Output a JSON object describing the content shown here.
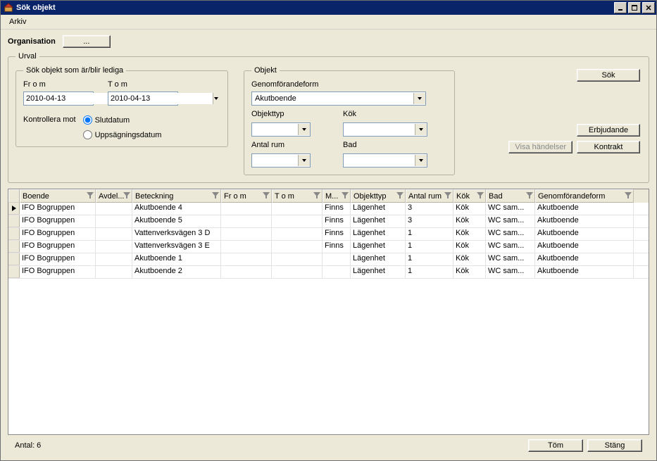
{
  "window": {
    "title": "Sök objekt"
  },
  "menu": {
    "arkiv": "Arkiv"
  },
  "top": {
    "organisation_label": "Organisation",
    "org_button": "..."
  },
  "urval": {
    "legend": "Urval",
    "dates_legend": "Sök objekt som är/blir lediga",
    "from_label": "Fr o m",
    "tom_label": "T o m",
    "from_value": "2010-04-13",
    "tom_value": "2010-04-13",
    "kontrollera_label": "Kontrollera mot",
    "radio_slut": "Slutdatum",
    "radio_upps": "Uppsägningsdatum",
    "objekt_legend": "Objekt",
    "genomf_label": "Genomförandeform",
    "genomf_value": "Akutboende",
    "objekttyp_label": "Objekttyp",
    "kok_label": "Kök",
    "antalrum_label": "Antal rum",
    "bad_label": "Bad"
  },
  "buttons": {
    "sok": "Sök",
    "erbjudande": "Erbjudande",
    "visa_handelser": "Visa händelser",
    "kontrakt": "Kontrakt",
    "tom": "Töm",
    "stang": "Stäng"
  },
  "table": {
    "headers": {
      "boende": "Boende",
      "avdel": "Avdel...",
      "beteck": "Beteckning",
      "from": "Fr o m",
      "tom": "T o m",
      "m": "M...",
      "objtyp": "Objekttyp",
      "antal": "Antal rum",
      "kok": "Kök",
      "bad": "Bad",
      "genom": "Genomförandeform"
    },
    "rows": [
      {
        "boende": "IFO Bogruppen",
        "avdel": "",
        "beteck": "Akutboende 4",
        "from": "",
        "tom": "",
        "m": "Finns",
        "objtyp": "Lägenhet",
        "antal": "3",
        "kok": "Kök",
        "bad": "WC sam...",
        "genom": "Akutboende"
      },
      {
        "boende": "IFO Bogruppen",
        "avdel": "",
        "beteck": "Akutboende 5",
        "from": "",
        "tom": "",
        "m": "Finns",
        "objtyp": "Lägenhet",
        "antal": "3",
        "kok": "Kök",
        "bad": "WC sam...",
        "genom": "Akutboende"
      },
      {
        "boende": "IFO Bogruppen",
        "avdel": "",
        "beteck": "Vattenverksvägen 3 D",
        "from": "",
        "tom": "",
        "m": "Finns",
        "objtyp": "Lägenhet",
        "antal": "1",
        "kok": "Kök",
        "bad": "WC sam...",
        "genom": "Akutboende"
      },
      {
        "boende": "IFO Bogruppen",
        "avdel": "",
        "beteck": "Vattenverksvägen 3 E",
        "from": "",
        "tom": "",
        "m": "Finns",
        "objtyp": "Lägenhet",
        "antal": "1",
        "kok": "Kök",
        "bad": "WC sam...",
        "genom": "Akutboende"
      },
      {
        "boende": "IFO Bogruppen",
        "avdel": "",
        "beteck": "Akutboende 1",
        "from": "",
        "tom": "",
        "m": "",
        "objtyp": "Lägenhet",
        "antal": "1",
        "kok": "Kök",
        "bad": "WC sam...",
        "genom": "Akutboende"
      },
      {
        "boende": "IFO Bogruppen",
        "avdel": "",
        "beteck": "Akutboende 2",
        "from": "",
        "tom": "",
        "m": "",
        "objtyp": "Lägenhet",
        "antal": "1",
        "kok": "Kök",
        "bad": "WC sam...",
        "genom": "Akutboende"
      }
    ]
  },
  "footer": {
    "antal_label": "Antal: 6"
  }
}
